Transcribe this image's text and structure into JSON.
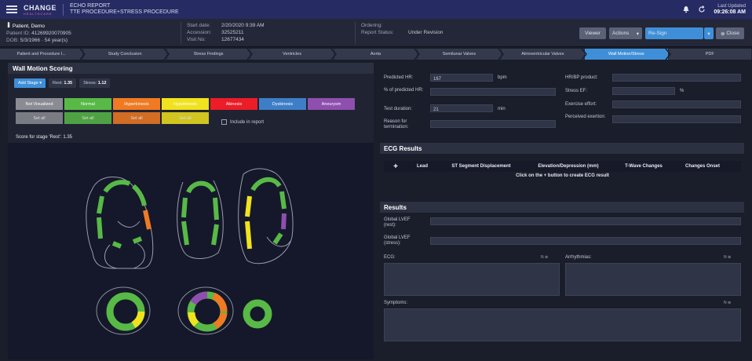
{
  "topbar": {
    "logo": "CHANGE",
    "logo_sub": "HEALTHCARE",
    "report_title": "ECHO REPORT",
    "report_sub": "TTE PROCEDURE+STRESS PROCEDURE",
    "last_updated_label": "Last Updated",
    "last_updated_time": "09:26:08 AM"
  },
  "patient": {
    "name": "Patient, Demo",
    "id_label": "Patient ID:",
    "id": "41269920070905",
    "dob_label": "DOB:",
    "dob": "5/3/1966 · 54 year(s)"
  },
  "visit": {
    "start_label": "Start date:",
    "start": "2/20/2020 9:39 AM",
    "accession_label": "Accession:",
    "accession": "32525211",
    "visit_label": "Visit No:",
    "visit_no": "12677434"
  },
  "ordering": {
    "ordering_label": "Ordering:",
    "status_label": "Report Status:",
    "status": "Under Revision"
  },
  "actions": {
    "viewer": "Viewer",
    "actions": "Actions",
    "resign": "Re-Sign",
    "close": "Close"
  },
  "nav": [
    "Patient and Procedure I...",
    "Study Conclusion",
    "Stress Findings",
    "Ventricles",
    "Aorta",
    "Semilunar Valves",
    "Atrioventricular Valves",
    "Wall Motion/Stress",
    "PDF"
  ],
  "wall_motion": {
    "title": "Wall Motion Scoring",
    "add_stage": "Add Stage",
    "rest_label": "Rest:",
    "rest": "1.35",
    "stress_label": "Stress:",
    "stress": "1.12",
    "buttons": [
      {
        "label": "Not Visualized",
        "color": "#8a8c93"
      },
      {
        "label": "Normal",
        "color": "#58b947"
      },
      {
        "label": "Hyperkinesis",
        "color": "#f07a22"
      },
      {
        "label": "Hypokinesis",
        "color": "#f0e21e"
      },
      {
        "label": "Akinesis",
        "color": "#ec1c28"
      },
      {
        "label": "Dyskinesis",
        "color": "#3e7ec6"
      },
      {
        "label": "Aneurysm",
        "color": "#8e4fae"
      }
    ],
    "set_all": [
      "Set all",
      "Set all",
      "Set all",
      "Set all"
    ],
    "include_label": "Include in report",
    "score_text": "Score for stage 'Rest': 1.35"
  },
  "stress_fields": {
    "predicted_hr_label": "Predicted HR:",
    "predicted_hr": "167",
    "predicted_hr_unit": "bpm",
    "pct_predicted_label": "% of predicted HR:",
    "test_duration_label": "Test duration:",
    "test_duration": "21",
    "test_duration_unit": "min",
    "reason_label": "Reason for termination:",
    "hrbp_label": "HR/BP product:",
    "stress_ef_label": "Stress EF:",
    "stress_ef_unit": "%",
    "exercise_label": "Exercise effort:",
    "perceived_label": "Perceived exertion:"
  },
  "ecg": {
    "title": "ECG Results",
    "add": "+",
    "columns": [
      "Lead",
      "ST Segment Displacement",
      "Elevation/Depression (mm)",
      "T-Wave Changes",
      "Changes Onset"
    ],
    "empty_msg": "Click on the + button to create ECG result"
  },
  "results": {
    "title": "Results",
    "global_rest_label": "Global LVEF (rest):",
    "global_stress_label": "Global LVEF (stress):",
    "ecg_label": "ECG:",
    "arrhythmias_label": "Arrhythmias:",
    "symptoms_label": "Symptoms:",
    "mini": "N"
  },
  "colors": {
    "normal": "#58b947",
    "hyper": "#f07a22",
    "hypo": "#f0e21e",
    "aneurysm": "#8e4fae",
    "accent": "#3f8fd8"
  }
}
